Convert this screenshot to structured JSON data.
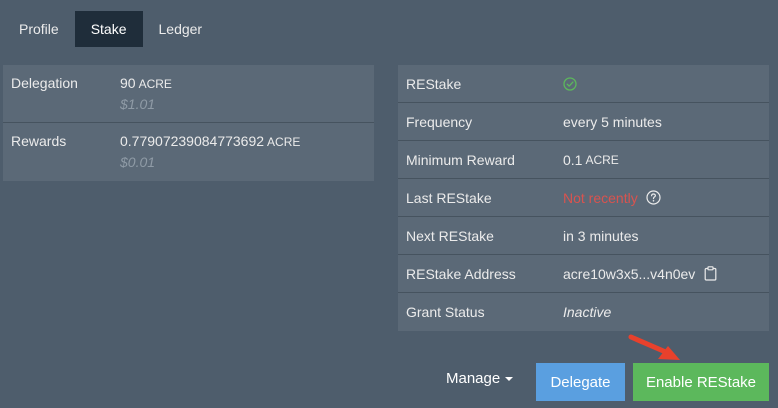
{
  "tabs": [
    {
      "label": "Profile"
    },
    {
      "label": "Stake"
    },
    {
      "label": "Ledger"
    }
  ],
  "delegation": {
    "rows": [
      {
        "label": "Delegation",
        "amount": "90",
        "unit": "ACRE",
        "fiat": "$1.01"
      },
      {
        "label": "Rewards",
        "amount": "0.77907239084773692",
        "unit": "ACRE",
        "fiat": "$0.01"
      }
    ]
  },
  "restake": {
    "rows": {
      "restake": {
        "label": "REStake",
        "icon": "check-circle-icon"
      },
      "frequency": {
        "label": "Frequency",
        "value": "every 5 minutes"
      },
      "minimum_reward": {
        "label": "Minimum Reward",
        "amount": "0.1",
        "unit": "ACRE"
      },
      "last_restake": {
        "label": "Last REStake",
        "value": "Not recently",
        "icon": "question-circle-icon"
      },
      "next_restake": {
        "label": "Next REStake",
        "value": "in 3 minutes"
      },
      "address": {
        "label": "REStake Address",
        "value": "acre10w3x5...v4n0ev",
        "icon": "clipboard-icon"
      },
      "grant_status": {
        "label": "Grant Status",
        "value": "Inactive"
      }
    }
  },
  "actions": {
    "manage_label": "Manage",
    "delegate_label": "Delegate",
    "enable_restake_label": "Enable REStake"
  },
  "colors": {
    "background": "#4e5d6c",
    "panel": "#5b6977",
    "tab_active": "#1f2d3a",
    "success": "#5cb85c",
    "info": "#5a9fe0",
    "danger": "#d9534f",
    "annotation_arrow": "#e8412c"
  }
}
